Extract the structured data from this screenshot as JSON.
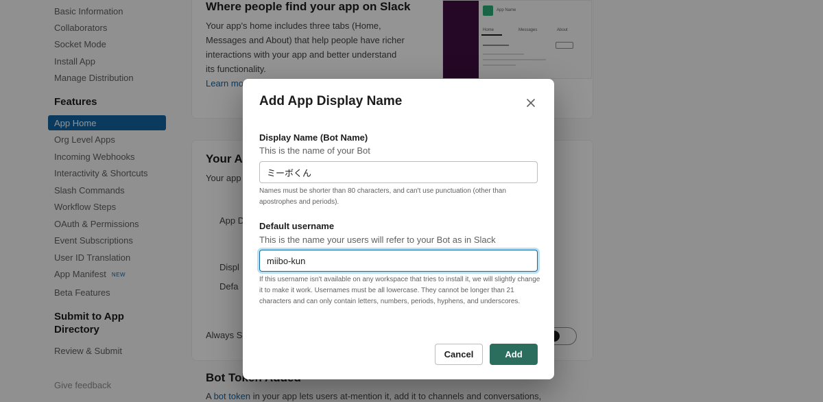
{
  "sidebar": {
    "items": [
      {
        "label": "Basic Information"
      },
      {
        "label": "Collaborators"
      },
      {
        "label": "Socket Mode"
      },
      {
        "label": "Install App"
      },
      {
        "label": "Manage Distribution"
      }
    ],
    "features_heading": "Features",
    "features": [
      {
        "label": "App Home"
      },
      {
        "label": "Org Level Apps"
      },
      {
        "label": "Incoming Webhooks"
      },
      {
        "label": "Interactivity & Shortcuts"
      },
      {
        "label": "Slash Commands"
      },
      {
        "label": "Workflow Steps"
      },
      {
        "label": "OAuth & Permissions"
      },
      {
        "label": "Event Subscriptions"
      },
      {
        "label": "User ID Translation"
      },
      {
        "label": "App Manifest"
      },
      {
        "label": "Beta Features"
      }
    ],
    "new_badge": "NEW",
    "submit_heading_line1": "Submit to App",
    "submit_heading_line2": "Directory",
    "review_label": "Review & Submit",
    "feedback_label": "Give feedback"
  },
  "main": {
    "section1_title": "Where people find your app on Slack",
    "section1_lines": [
      "Your app's home includes three tabs (Home,",
      "Messages and About) that help people have richer",
      "interactions with your app and better understand",
      "its functionality."
    ],
    "learn_more": "Learn mo",
    "section2_title": "Your Ap",
    "section2_sub": "Your app",
    "row_app_d": "App D",
    "row_displ": "Displ",
    "row_defa": "Defa",
    "always_s": "Always S",
    "bot_token_title": "Bot Token Added",
    "bot_line_start": "A ",
    "bot_token_link": "bot token",
    "bot_line_rest": " in your app lets users at-mention it, add it to channels and conversations,"
  },
  "preview": {
    "app_name": "App Name",
    "tabs": [
      "Home",
      "Messages",
      "About"
    ]
  },
  "modal": {
    "title": "Add App Display Name",
    "display_name_label": "Display Name (Bot Name)",
    "display_name_desc": "This is the name of your Bot",
    "display_name_value": "ミーボくん",
    "display_name_help": "Names must be shorter than 80 characters, and can't use punctuation (other than apostrophes and periods).",
    "username_label": "Default username",
    "username_desc": "This is the name your users will refer to your Bot as in Slack",
    "username_value": "miibo-kun",
    "username_help": "If this username isn't available on any workspace that tries to install it, we will slightly change it to make it work. Usernames must be all lowercase. They cannot be longer than 21 characters and can only contain letters, numbers, periods, hyphens, and underscores.",
    "cancel_label": "Cancel",
    "add_label": "Add"
  },
  "colors": {
    "accent": "#1264a3",
    "add_button": "#2b6e5e",
    "sidebar_dark": "#3f0e40"
  }
}
